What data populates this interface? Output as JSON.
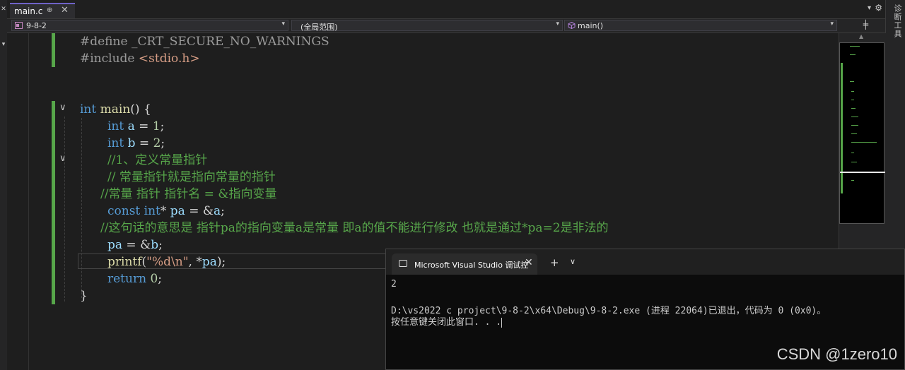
{
  "tab": {
    "filename": "main.c",
    "pin_glyph": "⊕",
    "close_glyph": "✕",
    "dropdown_glyph": "▾",
    "settings_glyph": "⚙"
  },
  "right_panel": {
    "label": "诊断工具"
  },
  "nav": {
    "project": "9-8-2",
    "scope": "(全局范围)",
    "function": "main()",
    "dropdown_glyph": "▾",
    "split_glyph": "╪"
  },
  "code_lines": [
    "#define _CRT_SECURE_NO_WARNINGS",
    "#include <stdio.h>",
    "",
    "",
    "int main() {",
    "int a = 1;",
    "int b = 2;",
    "//1、定义常量指针",
    "// 常量指针就是指向常量的指针",
    "//常量 指针 指针名 = &指向变量",
    "const int* pa = &a;",
    "//这句话的意思是 指针pa的指向变量a是常量 即a的值不能进行修改 也就是通过*pa=2是非法的",
    "pa = &b;",
    "printf(\"%d\\n\", *pa);",
    "return 0;",
    "}"
  ],
  "fold_glyph": "∨",
  "console": {
    "tab_title": "Microsoft Visual Studio 调试控",
    "close_glyph": "✕",
    "new_tab_glyph": "+",
    "menu_glyph": "∨",
    "output_lines": [
      "2",
      "",
      "D:\\vs2022 c project\\9-8-2\\x64\\Debug\\9-8-2.exe (进程 22064)已退出，代码为 0 (0x0)。",
      "按任意键关闭此窗口. . ."
    ]
  },
  "watermark": "CSDN @1zero10",
  "colors": {
    "keyword": "#569cd6",
    "comment": "#57a64a",
    "string": "#d69d85",
    "function": "#dcdcaa",
    "accent": "#6f62c7"
  }
}
